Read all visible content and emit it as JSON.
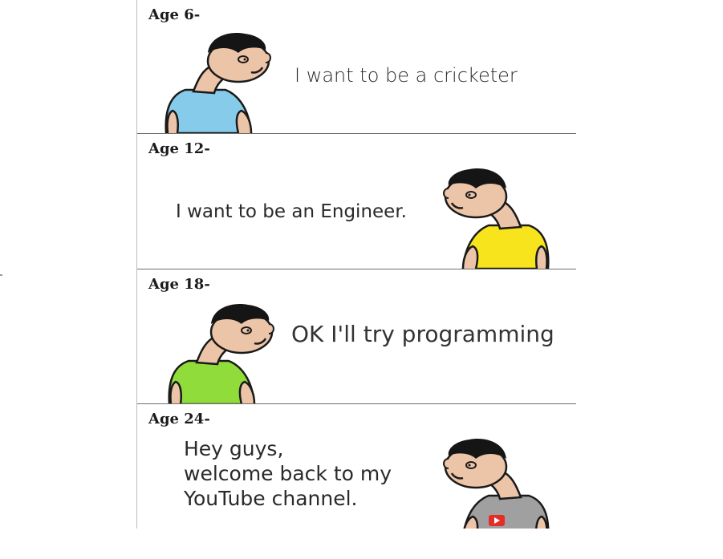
{
  "panels": [
    {
      "age_label": "Age 6-",
      "speech": [
        "I want to be a cricketer"
      ],
      "shirt_color": "#87cbea",
      "facing": "right"
    },
    {
      "age_label": "Age 12-",
      "speech": [
        "I want to be an Engineer."
      ],
      "shirt_color": "#f7e41c",
      "facing": "left"
    },
    {
      "age_label": "Age 18-",
      "speech": [
        "OK I'll try programming"
      ],
      "shirt_color": "#8fdc3a",
      "facing": "right"
    },
    {
      "age_label": "Age 24-",
      "speech": [
        "Hey guys,",
        "welcome back to my",
        "YouTube channel."
      ],
      "shirt_color": "#a0a0a0",
      "facing": "left",
      "shirt_icon": "youtube-logo-icon"
    }
  ],
  "colors": {
    "skin": "#ecc4a8",
    "hair": "#151515",
    "outline": "#1a1a1a",
    "youtube_red": "#e52d27"
  }
}
